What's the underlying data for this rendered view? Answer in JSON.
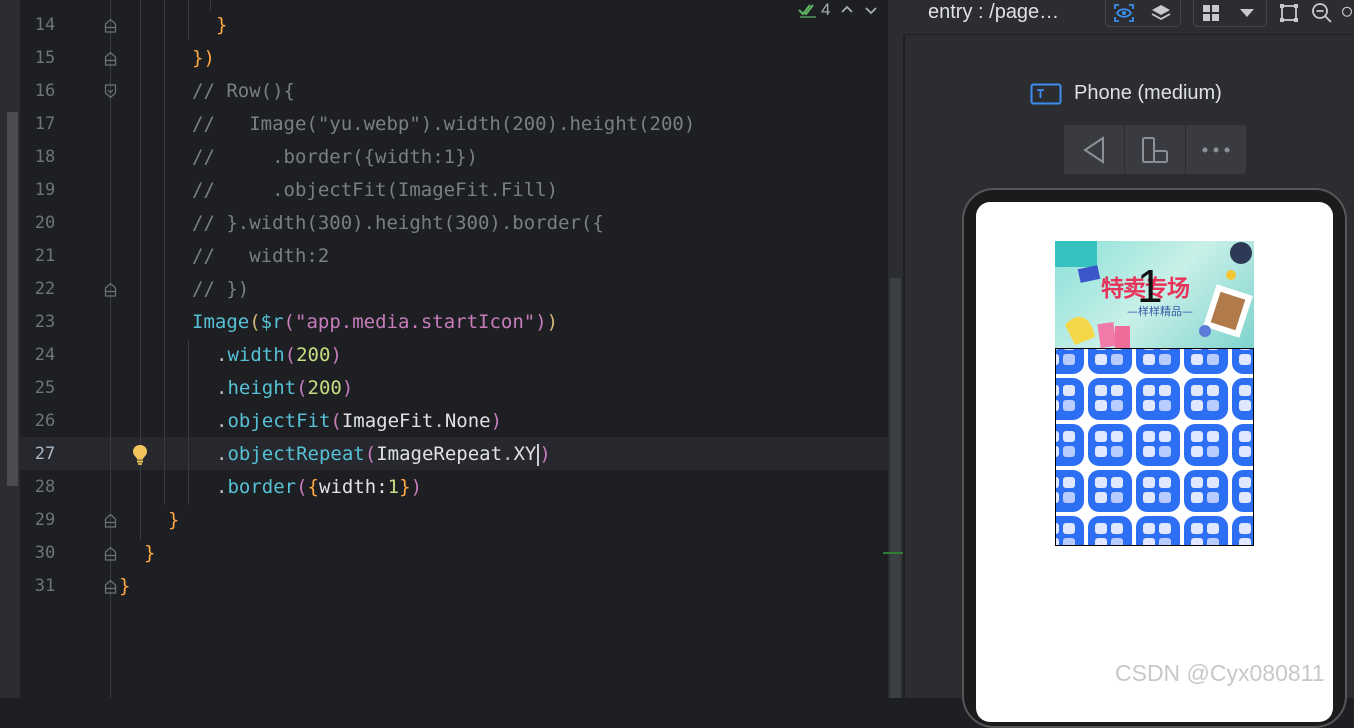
{
  "editor": {
    "lines": [
      {
        "n": "14"
      },
      {
        "n": "15"
      },
      {
        "n": "16"
      },
      {
        "n": "17"
      },
      {
        "n": "18"
      },
      {
        "n": "19"
      },
      {
        "n": "20"
      },
      {
        "n": "21"
      },
      {
        "n": "22"
      },
      {
        "n": "23"
      },
      {
        "n": "24"
      },
      {
        "n": "25"
      },
      {
        "n": "26"
      },
      {
        "n": "27"
      },
      {
        "n": "28"
      },
      {
        "n": "29"
      },
      {
        "n": "30"
      },
      {
        "n": "31"
      }
    ],
    "code": {
      "l14": "}",
      "l15": "})",
      "l16": "// Row(){",
      "l17": "//   Image(\"yu.webp\").width(200).height(200)",
      "l18": "//     .border({width:1})",
      "l19": "//     .objectFit(ImageFit.Fill)",
      "l20": "// }.width(300).height(300).border({",
      "l21": "//   width:2",
      "l22": "// })",
      "l23": {
        "fn": "Image",
        "p1": "(",
        "fn2": "$r",
        "p2": "(",
        "str": "\"app.media.startIcon\"",
        "p3": ")",
        "p4": ")"
      },
      "l24": {
        "dot": ".",
        "fn": "width",
        "p1": "(",
        "num": "200",
        "p2": ")"
      },
      "l25": {
        "dot": ".",
        "fn": "height",
        "p1": "(",
        "num": "200",
        "p2": ")"
      },
      "l26": {
        "dot": ".",
        "fn": "objectFit",
        "p1": "(",
        "arg": "ImageFit",
        "dot2": ".",
        "arg2": "None",
        "p2": ")"
      },
      "l27": {
        "dot": ".",
        "fn": "objectRepeat",
        "p1": "(",
        "arg": "ImageRepeat",
        "dot2": ".",
        "arg2": "XY",
        "p2": ")"
      },
      "l28": {
        "dot": ".",
        "fn": "border",
        "p1": "(",
        "b1": "{",
        "key": "width",
        "colon": ":",
        "num": "1",
        "b2": "}",
        "p2": ")"
      },
      "l29": "}",
      "l30": "}",
      "l31": "}"
    },
    "inspection_count": "4"
  },
  "preview": {
    "title": "entry : /page…",
    "device_label": "Phone (medium)",
    "banner_title": "特卖专场",
    "banner_subtitle": "—样样精品—",
    "banner_overlay_text": "1"
  },
  "watermark": "CSDN @Cyx080811"
}
